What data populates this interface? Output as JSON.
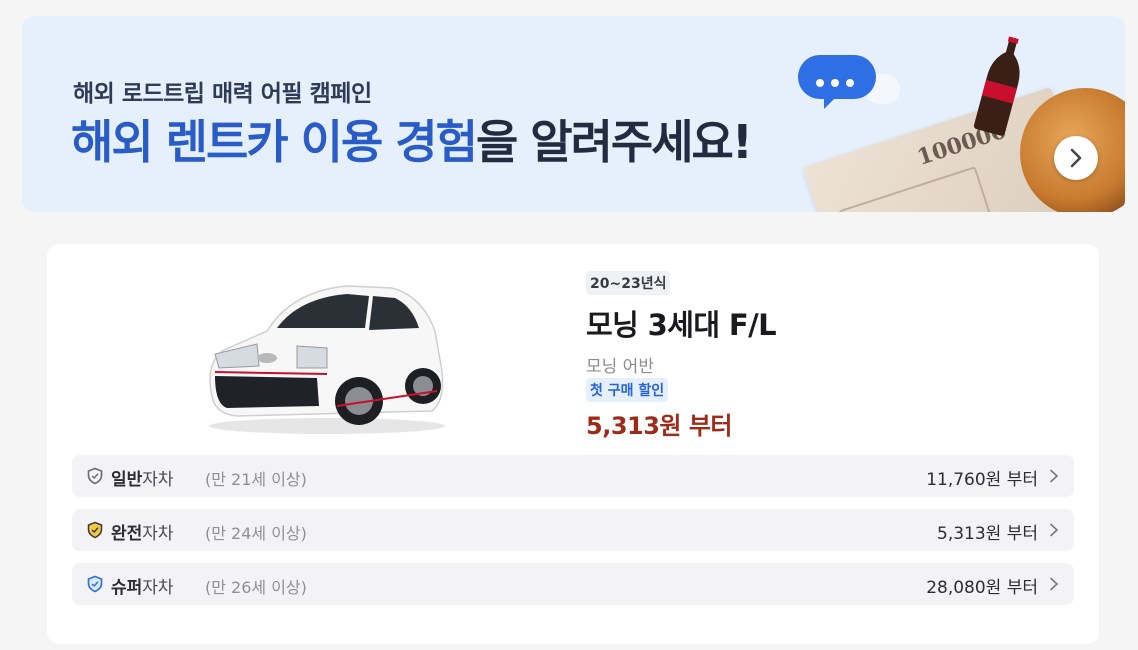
{
  "banner": {
    "subtitle": "해외 로드트립 매력 어필 캠페인",
    "title_part1": "해외 렌트카 이용 경험",
    "title_part2": "을 알려주세요!",
    "bill_amount": "100000",
    "next_icon": "chevron-right-icon"
  },
  "car": {
    "year_badge": "20~23년식",
    "name": "모닝 3세대 F/L",
    "trim": "모닝 어반",
    "promo_badge": "첫 구매 할인",
    "price_from": "5,313원 부터"
  },
  "insurance": [
    {
      "name": "일반",
      "suffix": "자차",
      "age": "(만 21세 이상)",
      "price": "11,760원 부터",
      "icon": "shield-icon",
      "icon_color": "#6b6d75"
    },
    {
      "name": "완전",
      "suffix": "자차",
      "age": "(만 24세 이상)",
      "price": "5,313원 부터",
      "icon": "shield-icon",
      "icon_color": "#e0a21b"
    },
    {
      "name": "슈퍼",
      "suffix": "자차",
      "age": "(만 26세 이상)",
      "price": "28,080원 부터",
      "icon": "shield-icon",
      "icon_color": "#2a6fd9"
    }
  ],
  "colors": {
    "accent_blue": "#2a5cc7",
    "price_red": "#9e2b1a",
    "promo_blue": "#2564d8"
  }
}
